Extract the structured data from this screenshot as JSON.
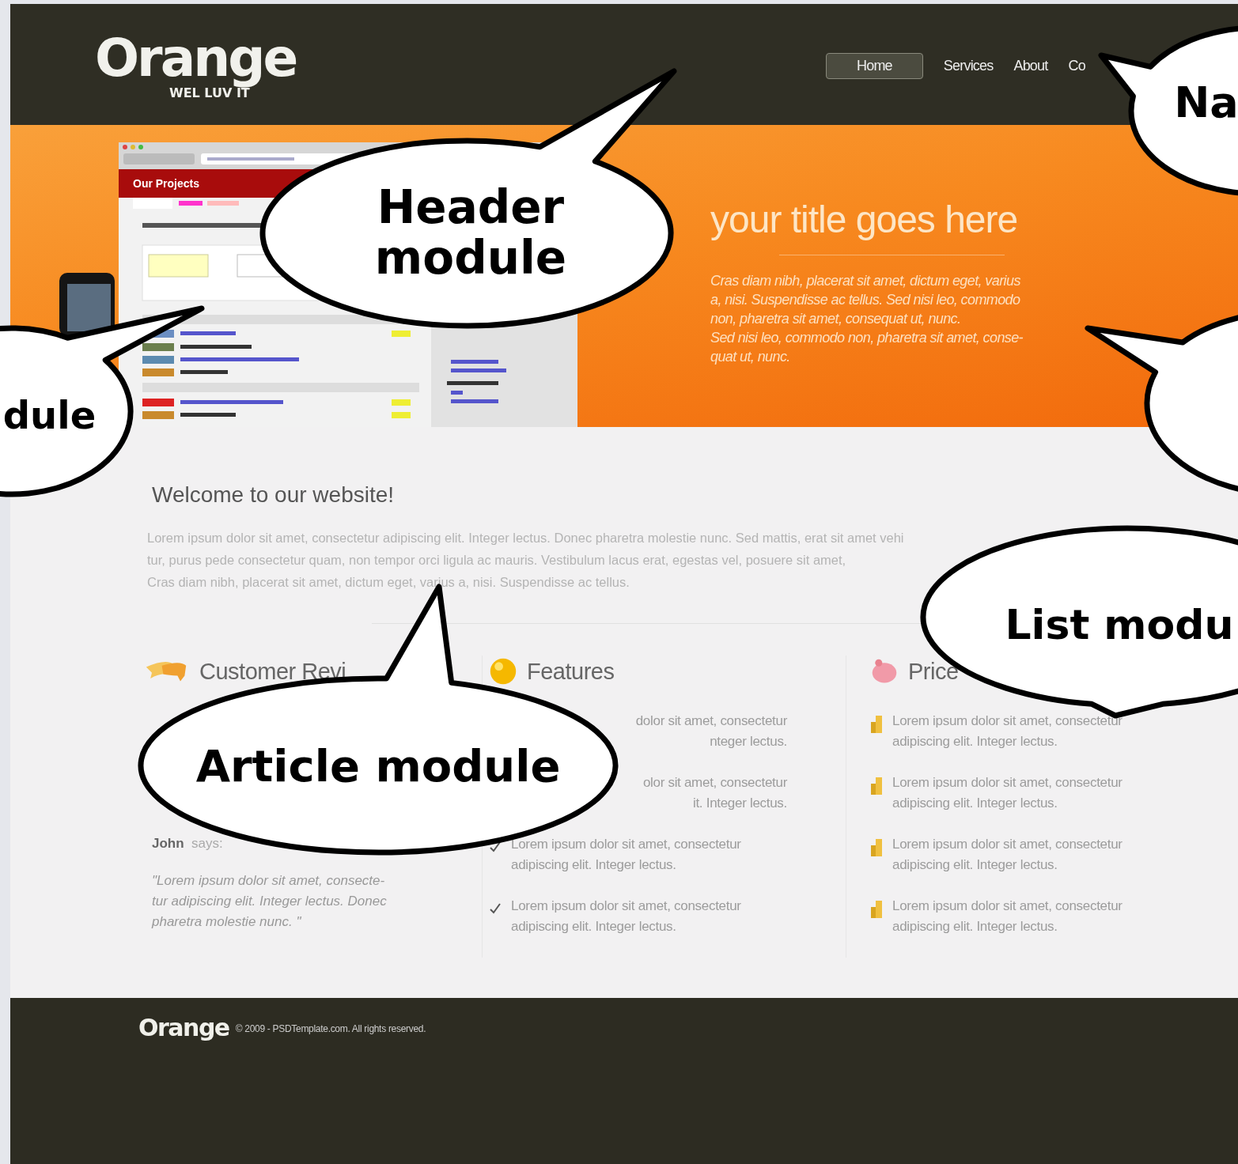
{
  "header": {
    "logo": {
      "name": "Orange",
      "tagline": "WEL LUV IT"
    },
    "nav": [
      {
        "label": "Home",
        "selected": true
      },
      {
        "label": "Services",
        "selected": false
      },
      {
        "label": "About",
        "selected": false
      },
      {
        "label": "Co",
        "selected": false
      }
    ]
  },
  "banner": {
    "screenshot": {
      "title": "Our Projects"
    },
    "title": "your title goes here",
    "text_lines": [
      "Cras diam nibh, placerat sit amet, dictum eget, varius",
      "a, nisi. Suspendisse ac tellus. Sed nisi leo, commodo",
      "non, pharetra sit amet, consequat ut, nunc.",
      "Sed nisi leo, commodo non, pharetra sit amet, conse-",
      "quat ut, nunc."
    ]
  },
  "welcome": {
    "heading": "Welcome to our website!",
    "text_lines": [
      "Lorem ipsum dolor sit amet, consectetur adipiscing elit. Integer lectus. Donec pharetra molestie nunc. Sed mattis, erat sit amet vehi",
      "tur, purus pede consectetur quam, non tempor orci ligula ac mauris. Vestibulum lacus erat, egestas vel, posuere sit amet,",
      "Cras diam nibh, placerat sit amet, dictum eget, varius a, nisi. Suspendisse ac tellus."
    ]
  },
  "columns": [
    {
      "kind": "reviews",
      "title": "Customer Revi",
      "author": "John",
      "verb": "says:",
      "quote_lines": [
        "\"Lorem ipsum dolor sit amet, consecte-",
        "tur adipiscing elit. Integer lectus. Donec",
        "pharetra molestie nunc. \""
      ]
    },
    {
      "kind": "features",
      "title": "Features",
      "items": [
        {
          "kind": "partial",
          "lines": [
            "dolor sit amet, consectetur",
            "nteger lectus."
          ]
        },
        {
          "kind": "partial",
          "lines": [
            "olor sit amet, consectetur",
            "it. Integer lectus."
          ]
        },
        {
          "kind": "full",
          "lines": [
            "Lorem ipsum dolor sit amet, consectetur",
            "adipiscing elit. Integer lectus."
          ]
        },
        {
          "kind": "full",
          "lines": [
            "Lorem ipsum dolor sit amet, consectetur",
            "adipiscing elit. Integer lectus."
          ]
        }
      ]
    },
    {
      "kind": "prices",
      "title": "Price",
      "items": [
        {
          "kind": "full",
          "lines": [
            "Lorem ipsum dolor sit amet, consectetur",
            "adipiscing elit. Integer lectus."
          ]
        },
        {
          "kind": "full",
          "lines": [
            "Lorem ipsum dolor sit amet, consectetur",
            "adipiscing elit. Integer lectus."
          ]
        },
        {
          "kind": "full",
          "lines": [
            "Lorem ipsum dolor sit amet, consectetur",
            "adipiscing elit. Integer lectus."
          ]
        },
        {
          "kind": "full",
          "lines": [
            "Lorem ipsum dolor sit amet, consectetur",
            "adipiscing elit. Integer lectus."
          ]
        }
      ]
    }
  ],
  "footer": {
    "logo": "Orange",
    "copyright": "© 2009 - PSDTemplate.com. All rights reserved."
  },
  "callouts": [
    {
      "kind": "labeled",
      "label": "Header module"
    },
    {
      "kind": "labeled",
      "label": "Na"
    },
    {
      "kind": "labeled",
      "label": "dule"
    },
    {
      "kind": "blank"
    },
    {
      "kind": "labeled",
      "label": "List modu"
    },
    {
      "kind": "labeled",
      "label": "Article module"
    }
  ]
}
